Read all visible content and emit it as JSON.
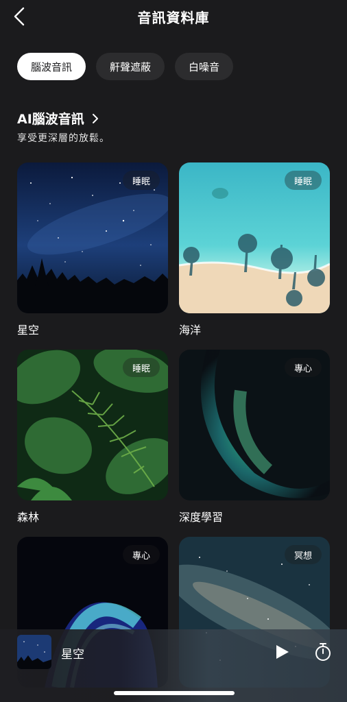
{
  "header": {
    "title": "音訊資料庫",
    "back_icon": "chevron-left-icon"
  },
  "tabs": [
    {
      "label": "腦波音訊",
      "active": true
    },
    {
      "label": "鼾聲遮蔽",
      "active": false
    },
    {
      "label": "白噪音",
      "active": false
    }
  ],
  "section": {
    "title": "AI腦波音訊",
    "subtitle": "享受更深層的放鬆。"
  },
  "cards": [
    {
      "label": "星空",
      "badge": "睡眠"
    },
    {
      "label": "海洋",
      "badge": "睡眠"
    },
    {
      "label": "森林",
      "badge": "睡眠"
    },
    {
      "label": "深度學習",
      "badge": "專心"
    },
    {
      "label": "",
      "badge": "專心"
    },
    {
      "label": "",
      "badge": "冥想"
    }
  ],
  "player": {
    "title": "星空",
    "play_icon": "play-icon",
    "timer_icon": "timer-icon"
  }
}
